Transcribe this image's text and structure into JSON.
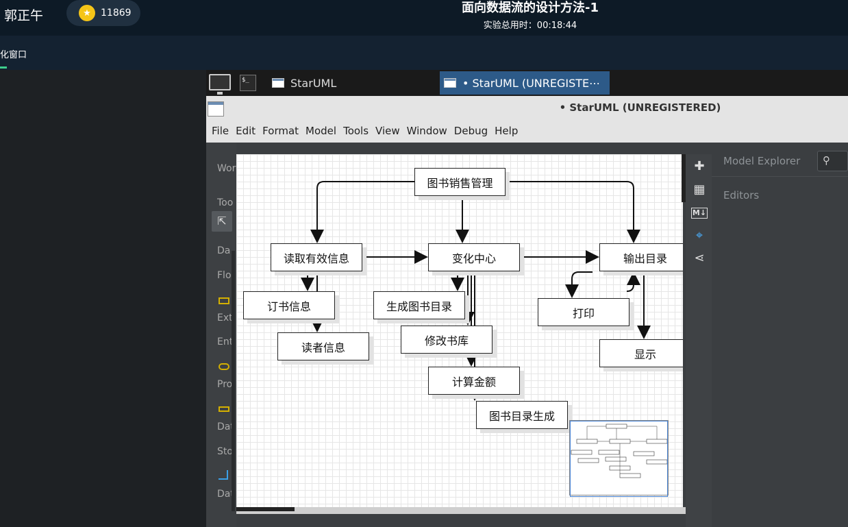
{
  "header": {
    "user_name": "郭正午",
    "coins": "11869",
    "lab_title": "面向数据流的设计方法-1",
    "lab_time": "实验总用时：00:18:44",
    "sub_label": "化窗口"
  },
  "taskbar": {
    "term_label": "$_",
    "task1": "StarUML",
    "task2": "• StarUML (UNREGISTE⋯"
  },
  "app": {
    "title": "• StarUML (UNREGISTERED)",
    "menu": [
      "File",
      "Edit",
      "Format",
      "Model",
      "Tools",
      "View",
      "Window",
      "Debug",
      "Help"
    ]
  },
  "toolbox": {
    "labels": [
      "Wor",
      "Too",
      "Da",
      "Flo",
      "Ext",
      "Ent",
      "Pro",
      "Dat",
      "Sto",
      "Dat"
    ]
  },
  "diagram": {
    "nodes": {
      "top": "图书销售管理",
      "left": "读取有效信息",
      "center": "变化中心",
      "right": "输出目录",
      "order": "订书信息",
      "reader": "读者信息",
      "gen": "生成图书目录",
      "modify": "修改书库",
      "calc": "计算金额",
      "catalog": "图书目录生成",
      "print": "打印",
      "display": "显示"
    }
  },
  "right_panel": {
    "model_explorer": "Model Explorer",
    "editors": "Editors"
  },
  "colors": {
    "header_bg": "#0d1a26",
    "coin": "#f5c518",
    "active_task": "#2d5a88",
    "accent": "#3ecf8e"
  }
}
